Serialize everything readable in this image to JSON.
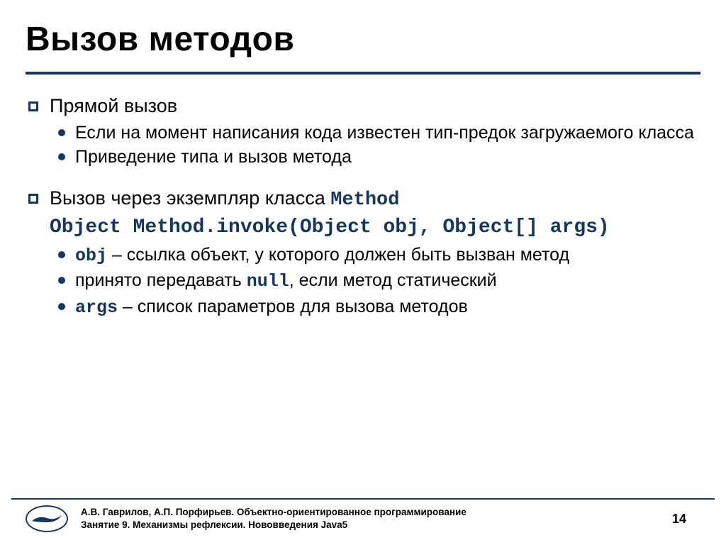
{
  "title": "Вызов методов",
  "bullets": {
    "b1": "Прямой вызов",
    "b1_1": "Если на момент написания кода известен тип-предок загружаемого класса",
    "b1_2": "Приведение типа и вызов метода",
    "b2_prefix": "Вызов через экземпляр класса ",
    "b2_code": "Method",
    "b2_codeblock": "Object Method.invoke(Object obj, Object[] args)",
    "b2_1_code": "obj",
    "b2_1_rest": " – ссылка объект, у которого должен быть вызван метод",
    "b2_2_a": "принято передавать ",
    "b2_2_code": "null",
    "b2_2_b": ", если метод статический",
    "b2_3_code": "args",
    "b2_3_rest": " – список параметров для вызова методов"
  },
  "footer": {
    "line1": "А.В. Гаврилов, А.П. Порфирьев. Объектно-ориентированное программирование",
    "line2": "Занятие 9. Механизмы рефлексии. Нововведения Java5",
    "page": "14"
  }
}
